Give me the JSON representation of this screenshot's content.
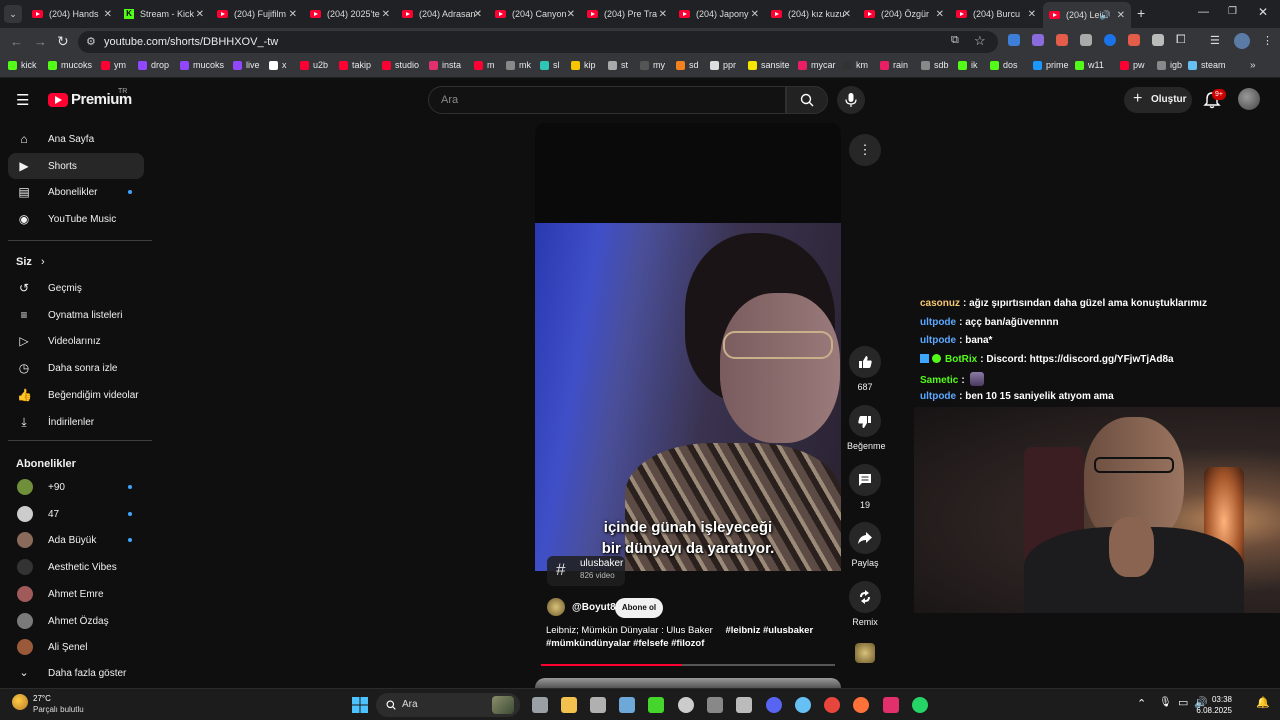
{
  "browser": {
    "tabs": [
      {
        "label": "(204) Hands",
        "icon": "youtube"
      },
      {
        "label": "Stream - Kick",
        "icon": "kick"
      },
      {
        "label": "(204) Fujifilm",
        "icon": "youtube"
      },
      {
        "label": "(204) 2025'te",
        "icon": "youtube"
      },
      {
        "label": "(204) Adrasan",
        "icon": "youtube"
      },
      {
        "label": "(204) Canyon",
        "icon": "youtube"
      },
      {
        "label": "(204) Pre Tra",
        "icon": "youtube"
      },
      {
        "label": "(204) Japony",
        "icon": "youtube"
      },
      {
        "label": "(204) kız kuzu",
        "icon": "youtube"
      },
      {
        "label": "(204) Özgür",
        "icon": "youtube"
      },
      {
        "label": "(204) Burcu",
        "icon": "youtube"
      },
      {
        "label": "(204) Lei",
        "icon": "youtube",
        "active": true
      }
    ],
    "new_tab": "+",
    "url": "youtube.com/shorts/DBHHXOV_-tw",
    "bookmarks": [
      {
        "label": "kick",
        "color": "#53fc18"
      },
      {
        "label": "mucoks",
        "color": "#53fc18"
      },
      {
        "label": "ym",
        "color": "#ff0033"
      },
      {
        "label": "drop",
        "color": "#9146ff"
      },
      {
        "label": "mucoks",
        "color": "#9146ff"
      },
      {
        "label": "live",
        "color": "#9146ff"
      },
      {
        "label": "x",
        "color": "#ffffff"
      },
      {
        "label": "u2b",
        "color": "#ff0033"
      },
      {
        "label": "takip",
        "color": "#ff0033"
      },
      {
        "label": "studio",
        "color": "#ff0033"
      },
      {
        "label": "insta",
        "color": "#e1306c"
      },
      {
        "label": "m",
        "color": "#ff0033"
      },
      {
        "label": "mk",
        "color": "#888888"
      },
      {
        "label": "sl",
        "color": "#2ec4b6"
      },
      {
        "label": "kip",
        "color": "#f7c600"
      },
      {
        "label": "st",
        "color": "#aaaaaa"
      },
      {
        "label": "my",
        "color": "#555555"
      },
      {
        "label": "sd",
        "color": "#f48120"
      },
      {
        "label": "ppr",
        "color": "#dddddd"
      },
      {
        "label": "sansite",
        "color": "#f7e600"
      },
      {
        "label": "mycar",
        "color": "#e91e63"
      },
      {
        "label": "km",
        "color": "#333333"
      },
      {
        "label": "rain",
        "color": "#e91e63"
      },
      {
        "label": "sdb",
        "color": "#888888"
      },
      {
        "label": "ik",
        "color": "#53fc18"
      },
      {
        "label": "dos",
        "color": "#53fc18"
      },
      {
        "label": "prime",
        "color": "#1a98ff"
      },
      {
        "label": "w11",
        "color": "#53fc18"
      },
      {
        "label": "pw",
        "color": "#ff0033"
      },
      {
        "label": "igb",
        "color": "#888888"
      },
      {
        "label": "steam",
        "color": "#66c0f4"
      }
    ]
  },
  "header": {
    "logo": "Premium",
    "logo_region": "TR",
    "search_placeholder": "Ara",
    "create_label": "Oluştur",
    "notifications_badge": "9+"
  },
  "sidebar": {
    "main": [
      {
        "label": "Ana Sayfa",
        "icon": "home-icon"
      },
      {
        "label": "Shorts",
        "icon": "shorts-icon",
        "active": true
      },
      {
        "label": "Abonelikler",
        "icon": "subscriptions-icon",
        "dot": true
      },
      {
        "label": "YouTube Music",
        "icon": "music-icon"
      }
    ],
    "you_header": "Siz",
    "you": [
      {
        "label": "Geçmiş",
        "icon": "history-icon"
      },
      {
        "label": "Oynatma listeleri",
        "icon": "playlists-icon"
      },
      {
        "label": "Videolarınız",
        "icon": "your-videos-icon"
      },
      {
        "label": "Daha sonra izle",
        "icon": "watch-later-icon"
      },
      {
        "label": "Beğendiğim videolar",
        "icon": "liked-icon"
      },
      {
        "label": "İndirilenler",
        "icon": "download-icon"
      }
    ],
    "subs_header": "Abonelikler",
    "subs": [
      {
        "label": "+90",
        "color": "#6f8f3a",
        "dot": true
      },
      {
        "label": "47",
        "color": "#cccccc",
        "dot": true
      },
      {
        "label": "Ada Büyük",
        "color": "#8a6a5a",
        "dot": true
      },
      {
        "label": "Aesthetic Vibes",
        "color": "#333333",
        "dot": false
      },
      {
        "label": "Ahmet Emre",
        "color": "#a05a5a",
        "dot": false
      },
      {
        "label": "Ahmet Özdaş",
        "color": "#7a7a7a",
        "dot": false
      },
      {
        "label": "Ali Şenel",
        "color": "#9a5a3a",
        "dot": false
      }
    ],
    "more_label": "Daha fazla göster"
  },
  "short": {
    "subtitle_line1": "içinde günah işleyeceği",
    "subtitle_line2": "bir dünyayı da yaratıyor.",
    "hashtag_name": "ulusbaker",
    "hashtag_count": "826 video",
    "channel": "@Boyut8",
    "subscribe_label": "Abone ol",
    "title_line1": "Leibniz; Mümkün Dünyalar : Ulus Baker",
    "title_tags1": "#leibniz #ulusbaker",
    "title_line2": "#mümkündünyalar #felsefe #filozof",
    "progress_fraction": 0.48
  },
  "actions": {
    "like_count": "687",
    "dislike_label": "Beğenme",
    "comment_count": "19",
    "share_label": "Paylaş",
    "remix_label": "Remix"
  },
  "chat": [
    {
      "user": "casonuz",
      "color": "#f7c873",
      "text": ": ağız şıpırtısından daha güzel ama konuştuklarımız"
    },
    {
      "user": "ultpode",
      "color": "#5aa8ff",
      "text": ": açç ban/ağüvennnn"
    },
    {
      "user": "ultpode",
      "color": "#5aa8ff",
      "text": ": bana*"
    },
    {
      "user": "BotRix",
      "color": "#53fc18",
      "text": ": Discord: https://discord.gg/YFjwTjAd8a"
    },
    {
      "user": "Sametic",
      "color": "#53fc18",
      "text": ":"
    },
    {
      "user": "ultpode",
      "color": "#5aa8ff",
      "text": ": ben 10 15 saniyelik atıyom ama"
    }
  ],
  "taskbar": {
    "weather_temp": "27°C",
    "weather_desc": "Parçalı bulutlu",
    "search_label": "Ara",
    "time": "03:38",
    "date": "6.08.2025"
  }
}
